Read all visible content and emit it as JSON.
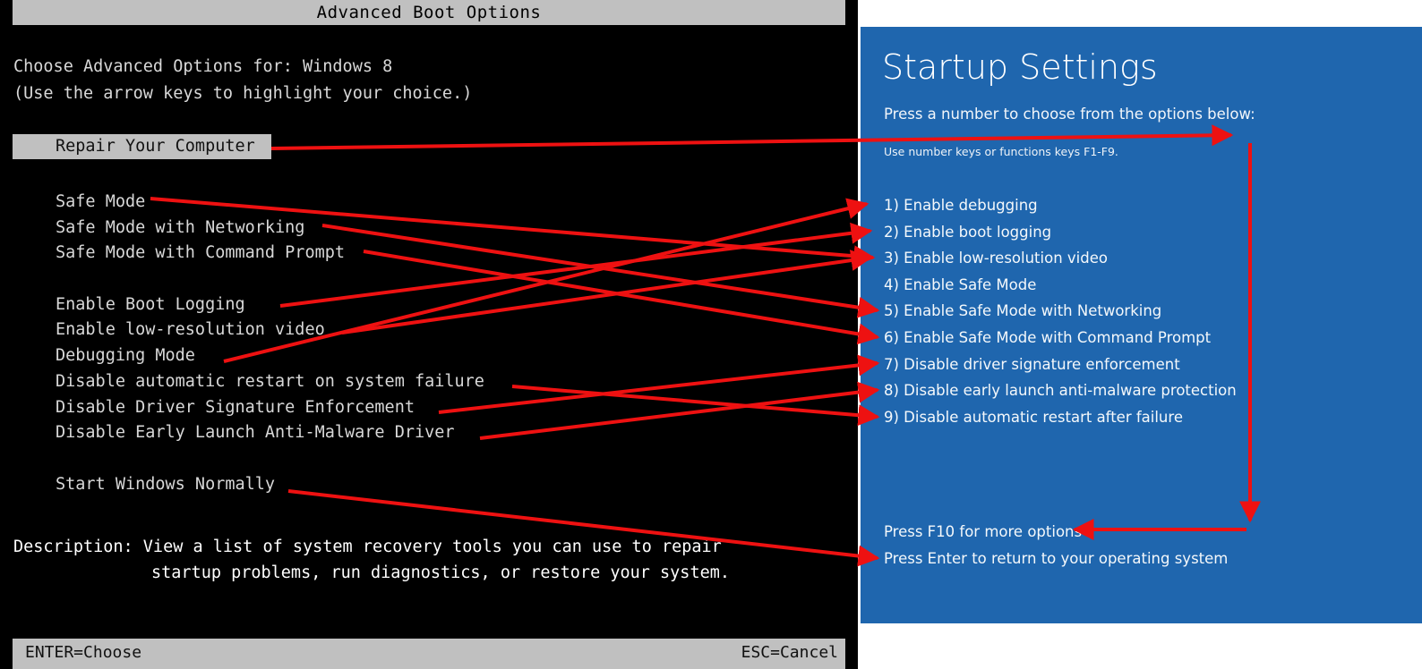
{
  "legacy": {
    "title": "Advanced Boot Options",
    "intro_line_1": "Choose Advanced Options for: Windows 8",
    "intro_line_2": "(Use the arrow keys to highlight your choice.)",
    "highlighted_option": "Repair Your Computer",
    "options": [
      "Safe Mode",
      "Safe Mode with Networking",
      "Safe Mode with Command Prompt",
      "",
      "Enable Boot Logging",
      "Enable low-resolution video",
      "Debugging Mode",
      "Disable automatic restart on system failure",
      "Disable Driver Signature Enforcement",
      "Disable Early Launch Anti-Malware Driver",
      "",
      "Start Windows Normally"
    ],
    "description_line_1": "Description: View a list of system recovery tools you can use to repair",
    "description_line_2": "startup problems, run diagnostics, or restore your system.",
    "status_left": "ENTER=Choose",
    "status_right": "ESC=Cancel",
    "colors": {
      "background": "#000000",
      "chrome": "#c0c0c0",
      "text": "#d8d8d8"
    }
  },
  "startup": {
    "title": "Startup Settings",
    "prompt": "Press a number to choose from the options below:",
    "hint": "Use number keys or functions keys F1-F9.",
    "options": [
      "1) Enable debugging",
      "2) Enable boot logging",
      "3) Enable low-resolution video",
      "4) Enable Safe Mode",
      "5) Enable Safe Mode with Networking",
      "6) Enable Safe Mode with Command Prompt",
      "7) Disable driver signature enforcement",
      "8) Disable early launch anti-malware protection",
      "9) Disable automatic restart after failure"
    ],
    "footer": [
      "Press F10 for more options",
      "Press Enter to return to your operating system"
    ],
    "colors": {
      "background": "#1f66ae",
      "text": "#ffffff"
    }
  },
  "annotations": {
    "color": "#ee1111",
    "description": "Red arrows mapping each legacy Advanced Boot Options entry to its Windows 8 Startup Settings equivalent"
  }
}
